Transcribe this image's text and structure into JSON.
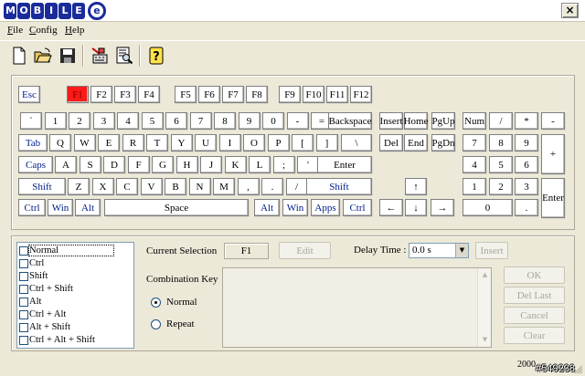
{
  "app": {
    "logo_letters": [
      "M",
      "O",
      "B",
      "I",
      "L",
      "E"
    ],
    "logo_mark": "e",
    "close": "×"
  },
  "menu": [
    "File",
    "Config",
    "Help"
  ],
  "toolbar": {
    "buttons": [
      "new-file-icon",
      "open-folder-icon",
      "save-disk-icon",
      "keyboard-edit-icon",
      "search-doc-icon",
      "help-icon"
    ],
    "help_glyph": "?"
  },
  "keyboard": {
    "selected_key": "F1",
    "row_fn": [
      "Esc",
      "F1",
      "F2",
      "F3",
      "F4",
      "F5",
      "F6",
      "F7",
      "F8",
      "F9",
      "F10",
      "F11",
      "F12"
    ],
    "row_num": [
      "`",
      "1",
      "2",
      "3",
      "4",
      "5",
      "6",
      "7",
      "8",
      "9",
      "0",
      "-",
      "=",
      "Backspace"
    ],
    "row_tab": [
      "Tab",
      "Q",
      "W",
      "E",
      "R",
      "T",
      "Y",
      "U",
      "I",
      "O",
      "P",
      "[",
      "]",
      "\\"
    ],
    "row_caps": [
      "Caps",
      "A",
      "S",
      "D",
      "F",
      "G",
      "H",
      "J",
      "K",
      "L",
      ";",
      "'",
      "Enter"
    ],
    "row_shift": [
      "Shift",
      "Z",
      "X",
      "C",
      "V",
      "B",
      "N",
      "M",
      ",",
      ".",
      "/",
      "Shift"
    ],
    "row_ctrl": [
      "Ctrl",
      "Win",
      "Alt",
      "Space",
      "Alt",
      "Win",
      "Apps",
      "Ctrl"
    ],
    "nav_top": [
      "Insert",
      "Home",
      "PgUp"
    ],
    "nav_bottom": [
      "Del",
      "End",
      "PgDn"
    ],
    "arrows": [
      "↑",
      "←",
      "↓",
      "→"
    ],
    "numpad_row1": [
      "Num",
      "/",
      "*",
      "-"
    ],
    "numpad_row2": [
      "7",
      "8",
      "9"
    ],
    "numpad_row3": [
      "4",
      "5",
      "6"
    ],
    "numpad_row4": [
      "1",
      "2",
      "3"
    ],
    "numpad_row5": [
      "0",
      "."
    ],
    "numpad_plus": "+",
    "numpad_enter": "Enter"
  },
  "modifiers": [
    "Normal",
    "Ctrl",
    "Shift",
    "Ctrl + Shift",
    "Alt",
    "Ctrl + Alt",
    "Alt + Shift",
    "Ctrl + Alt + Shift"
  ],
  "form": {
    "current_selection_label": "Current Selection",
    "current_selection_value": "F1",
    "edit_button": "Edit",
    "delay_label": "Delay Time :",
    "delay_value": "0.0 s",
    "insert_button": "Insert",
    "combination_label": "Combination Key",
    "radio_normal": "Normal",
    "radio_repeat": "Repeat",
    "buttons": [
      "OK",
      "Del Last",
      "Cancel",
      "Clear"
    ]
  },
  "status": {
    "text": "2000",
    "watermark": "#549238"
  }
}
